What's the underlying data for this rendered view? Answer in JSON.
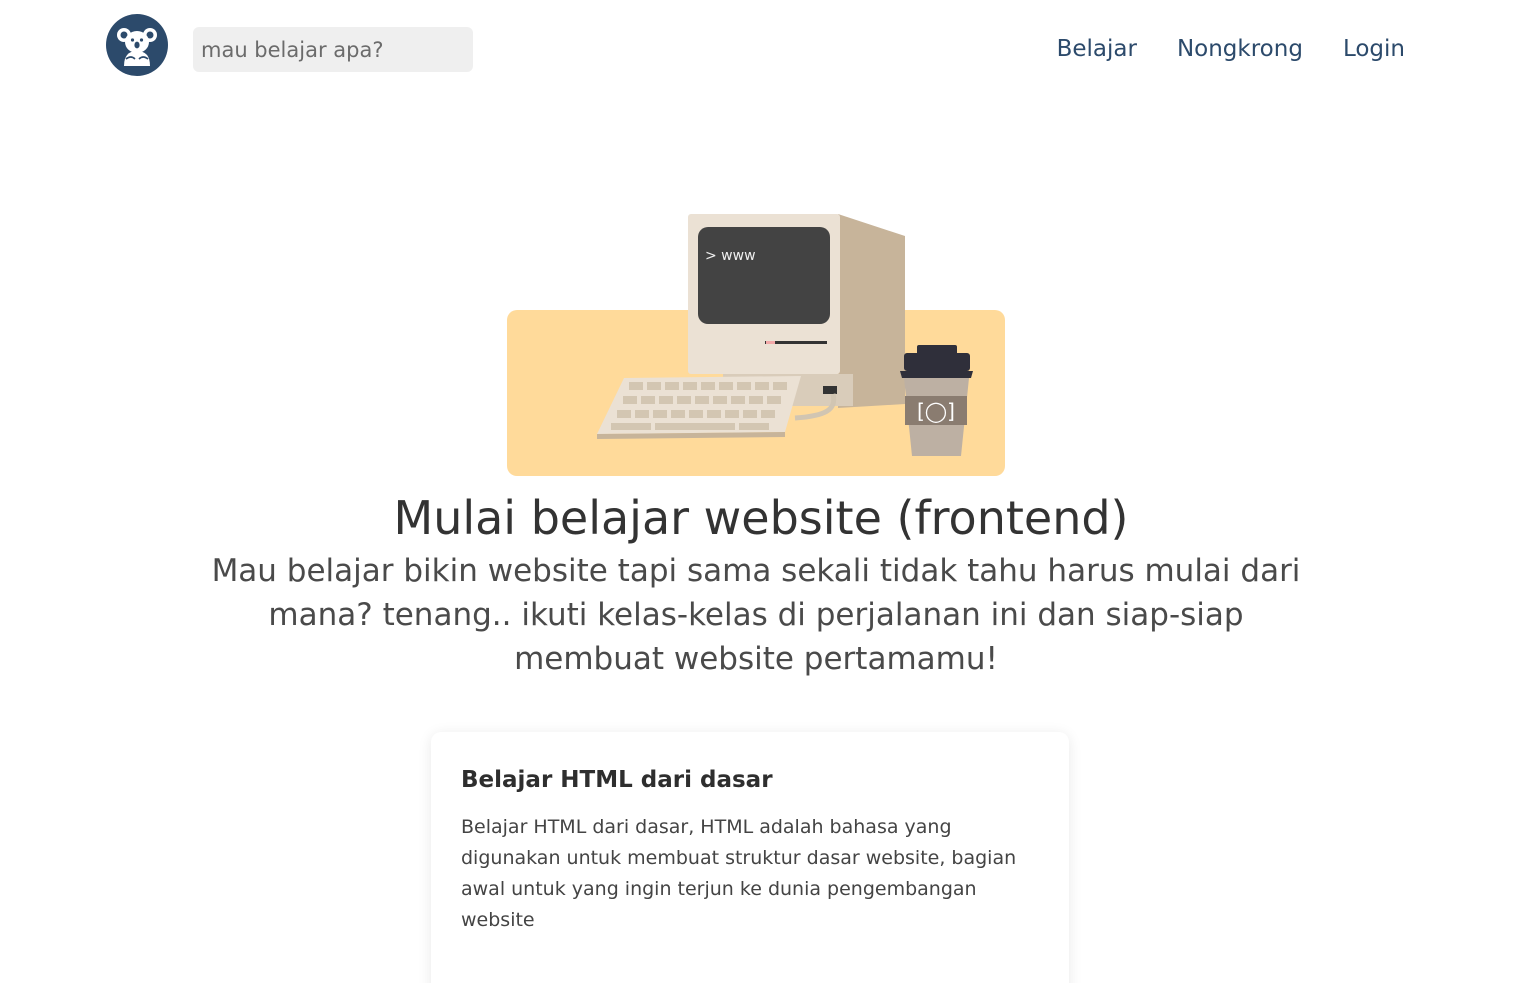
{
  "header": {
    "logo_icon": "koala-icon",
    "search": {
      "placeholder": "mau belajar apa?",
      "value": ""
    },
    "nav": [
      {
        "label": "Belajar"
      },
      {
        "label": "Nongkrong"
      },
      {
        "label": "Login"
      }
    ]
  },
  "hero": {
    "illustration_screen_text": "> www",
    "title": "Mulai belajar website (frontend)",
    "subtitle": "Mau belajar bikin website tapi sama sekali tidak tahu harus mulai dari mana? tenang.. ikuti kelas-kelas di perjalanan ini dan siap-siap membuat website pertamamu!"
  },
  "courses": [
    {
      "title": "Belajar HTML dari dasar",
      "description": "Belajar HTML dari dasar, HTML adalah bahasa yang digunakan untuk membuat struktur dasar website, bagian awal untuk yang ingin terjun ke dunia pengembangan website"
    }
  ],
  "colors": {
    "brand": "#2c4a6b",
    "illustration_bg": "#ffda9a",
    "search_bg": "#efefef"
  }
}
